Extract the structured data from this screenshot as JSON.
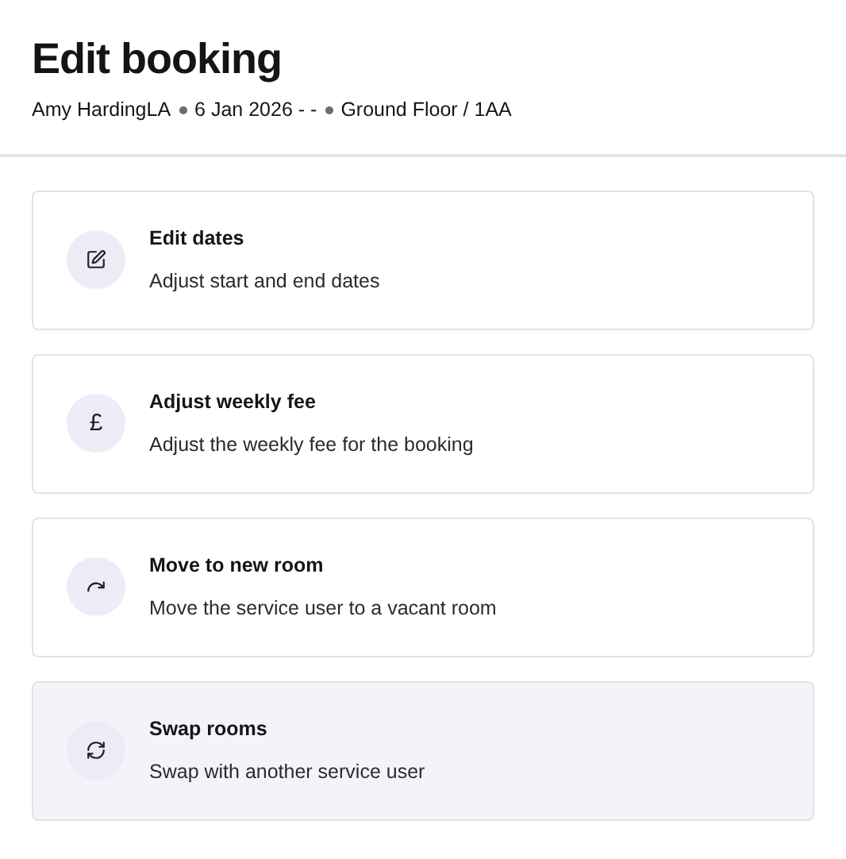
{
  "title": "Edit booking",
  "subtitle": [
    "Amy HardingLA",
    "6 Jan 2026 - -",
    "Ground Floor / 1AA"
  ],
  "options": [
    {
      "kind": "edit",
      "title": "Edit dates",
      "description": "Adjust start and end dates",
      "selected": false
    },
    {
      "kind": "fee",
      "symbol": "£",
      "title": "Adjust weekly fee",
      "description": "Adjust the weekly fee for the booking",
      "selected": false
    },
    {
      "kind": "move",
      "title": "Move to new room",
      "description": "Move the service user to a vacant room",
      "selected": false
    },
    {
      "kind": "swap",
      "title": "Swap rooms",
      "description": "Swap with another service user",
      "selected": true
    }
  ]
}
